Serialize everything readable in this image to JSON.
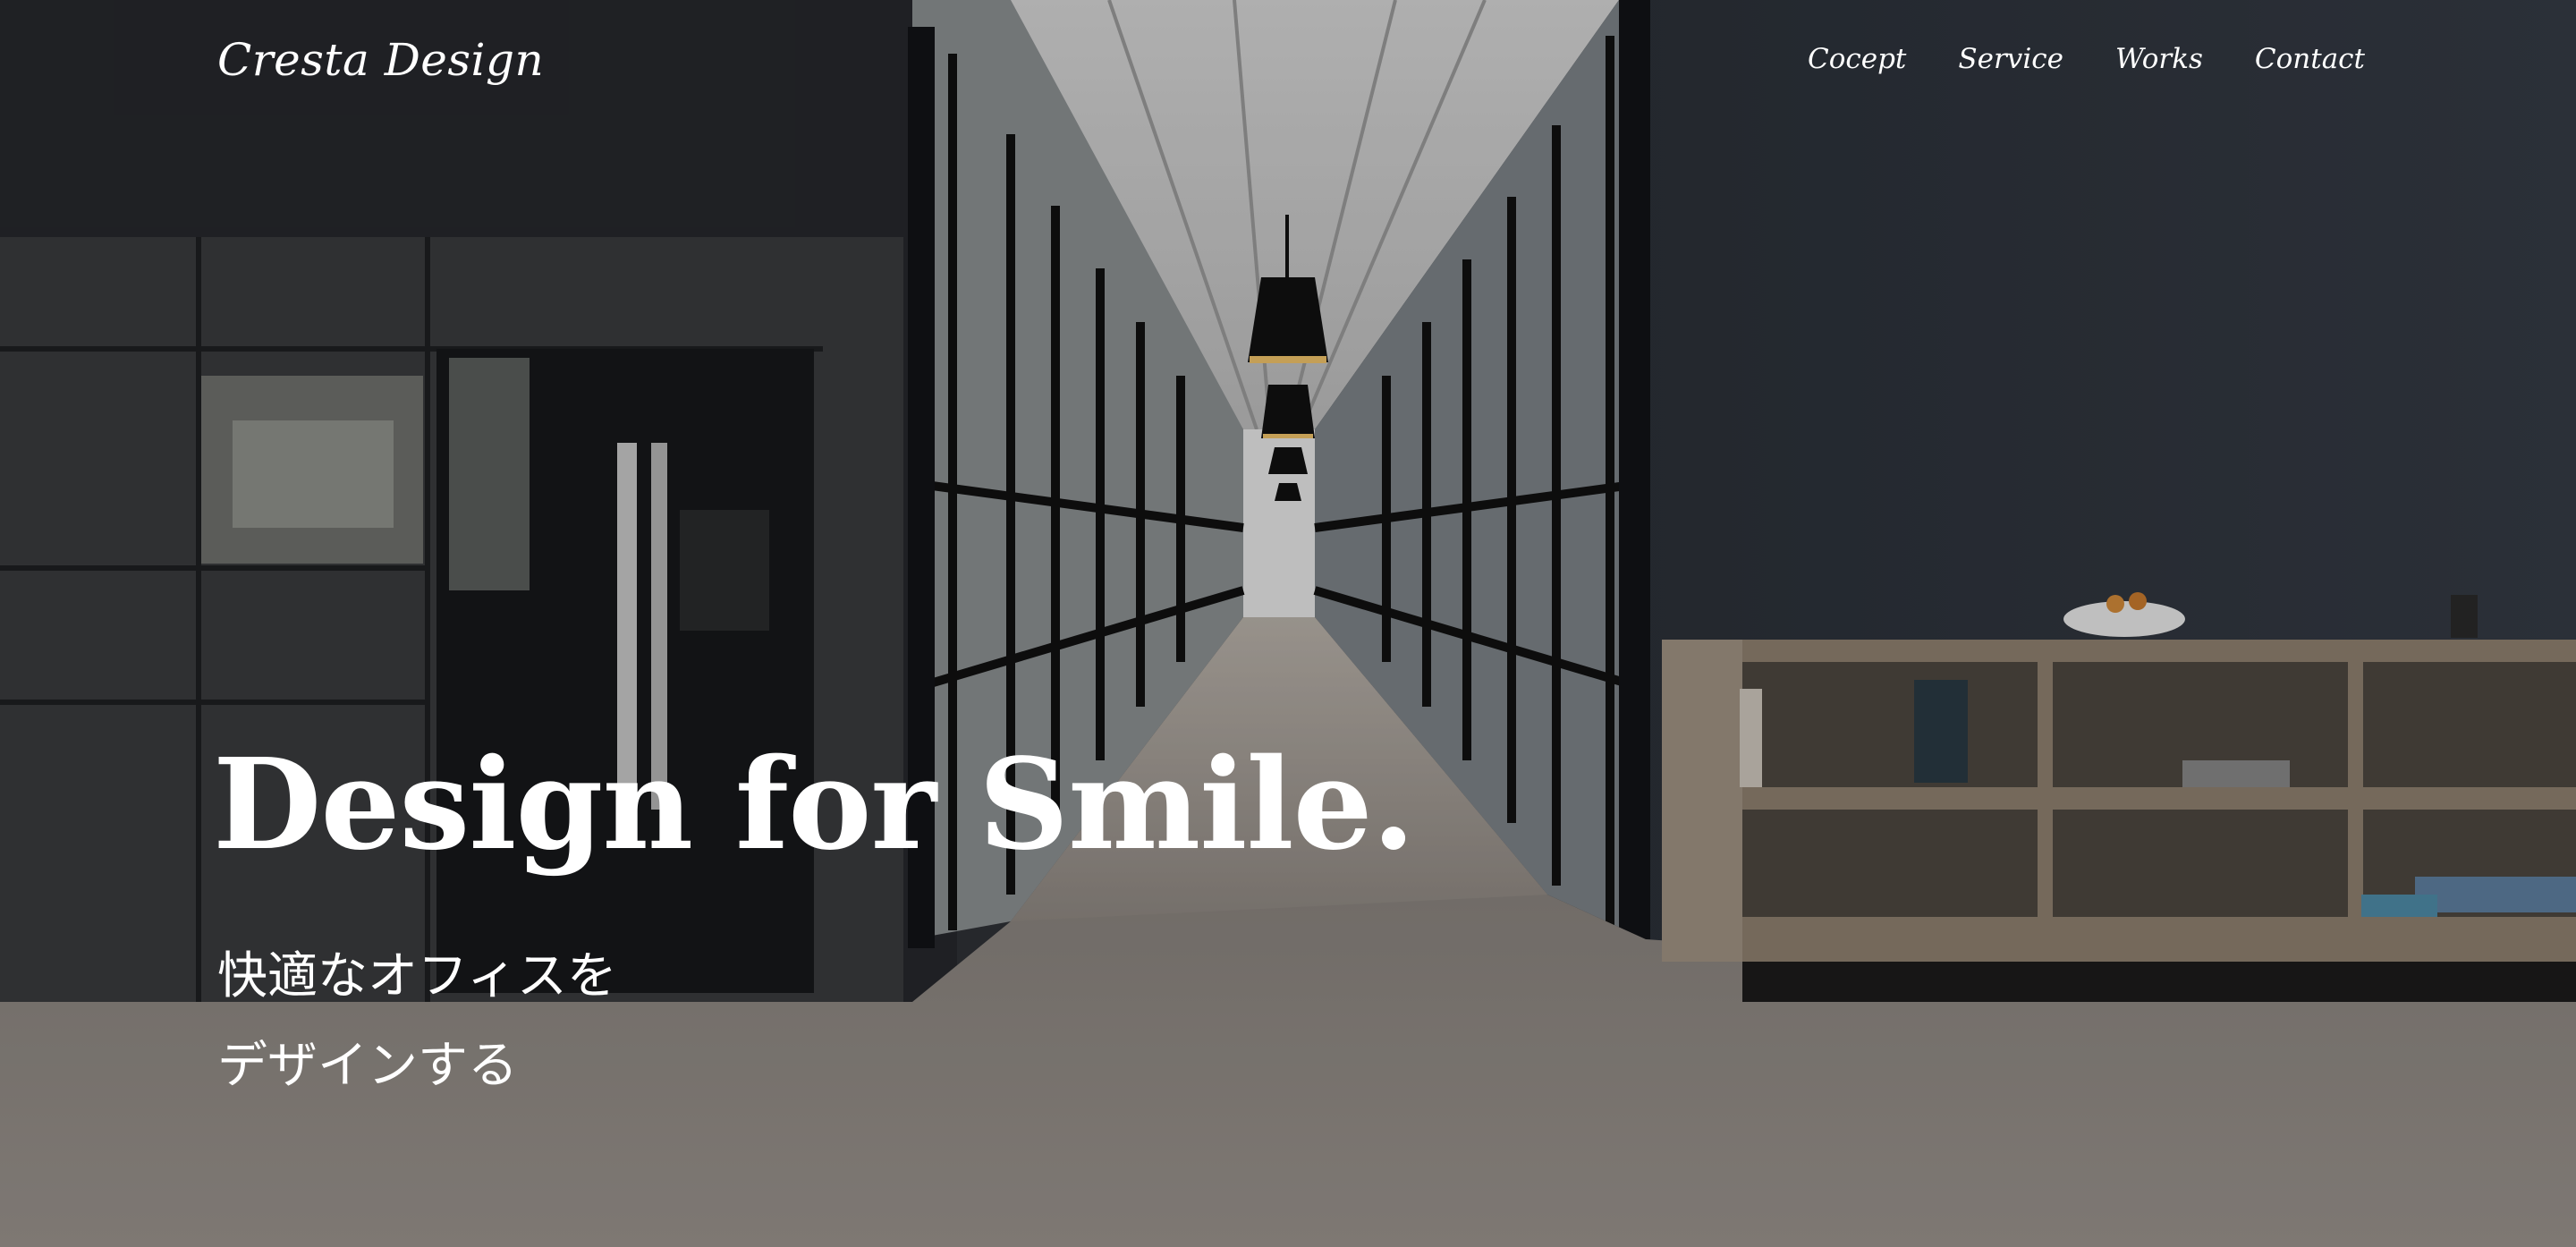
{
  "site": {
    "logo": "Cresta Design"
  },
  "nav": {
    "items": [
      {
        "label": "Cocept"
      },
      {
        "label": "Service"
      },
      {
        "label": "Works"
      },
      {
        "label": "Contact"
      }
    ]
  },
  "hero": {
    "headline": "Design for Smile.",
    "subcopy_line1": "快適なオフィスを",
    "subcopy_line2": "デザインする"
  },
  "colors": {
    "text": "#ffffff",
    "wall": "#2f343d",
    "floor": "#8a847f",
    "shelf": "#8e7f70"
  }
}
